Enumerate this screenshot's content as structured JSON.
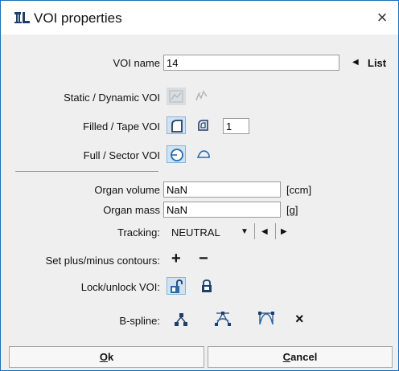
{
  "window": {
    "title": "VOI properties",
    "close_glyph": "×"
  },
  "voi_name": {
    "label": "VOI name",
    "value": "14",
    "list_label": "List"
  },
  "static_dynamic": {
    "label": "Static / Dynamic VOI"
  },
  "filled_tape": {
    "label": "Filled / Tape VOI",
    "tape_value": "1"
  },
  "full_sector": {
    "label": "Full / Sector VOI"
  },
  "organ_volume": {
    "label": "Organ volume",
    "value": "NaN",
    "unit": "[ccm]"
  },
  "organ_mass": {
    "label": "Organ mass",
    "value": "NaN",
    "unit": "[g]"
  },
  "tracking": {
    "label": "Tracking:",
    "value": "NEUTRAL"
  },
  "plus_minus": {
    "label": "Set plus/minus contours:",
    "plus": "+",
    "minus": "−"
  },
  "lock": {
    "label": "Lock/unlock VOI:"
  },
  "bspline": {
    "label": "B-spline:",
    "clear": "×"
  },
  "buttons": {
    "ok_prefix": "O",
    "ok_rest": "k",
    "cancel_prefix": "C",
    "cancel_rest": "ancel"
  },
  "colors": {
    "accent": "#1c6fb8",
    "selected_bg": "#cfe3f5",
    "icon_blue": "#2a6aa8",
    "icon_navy": "#1d3f6e"
  }
}
